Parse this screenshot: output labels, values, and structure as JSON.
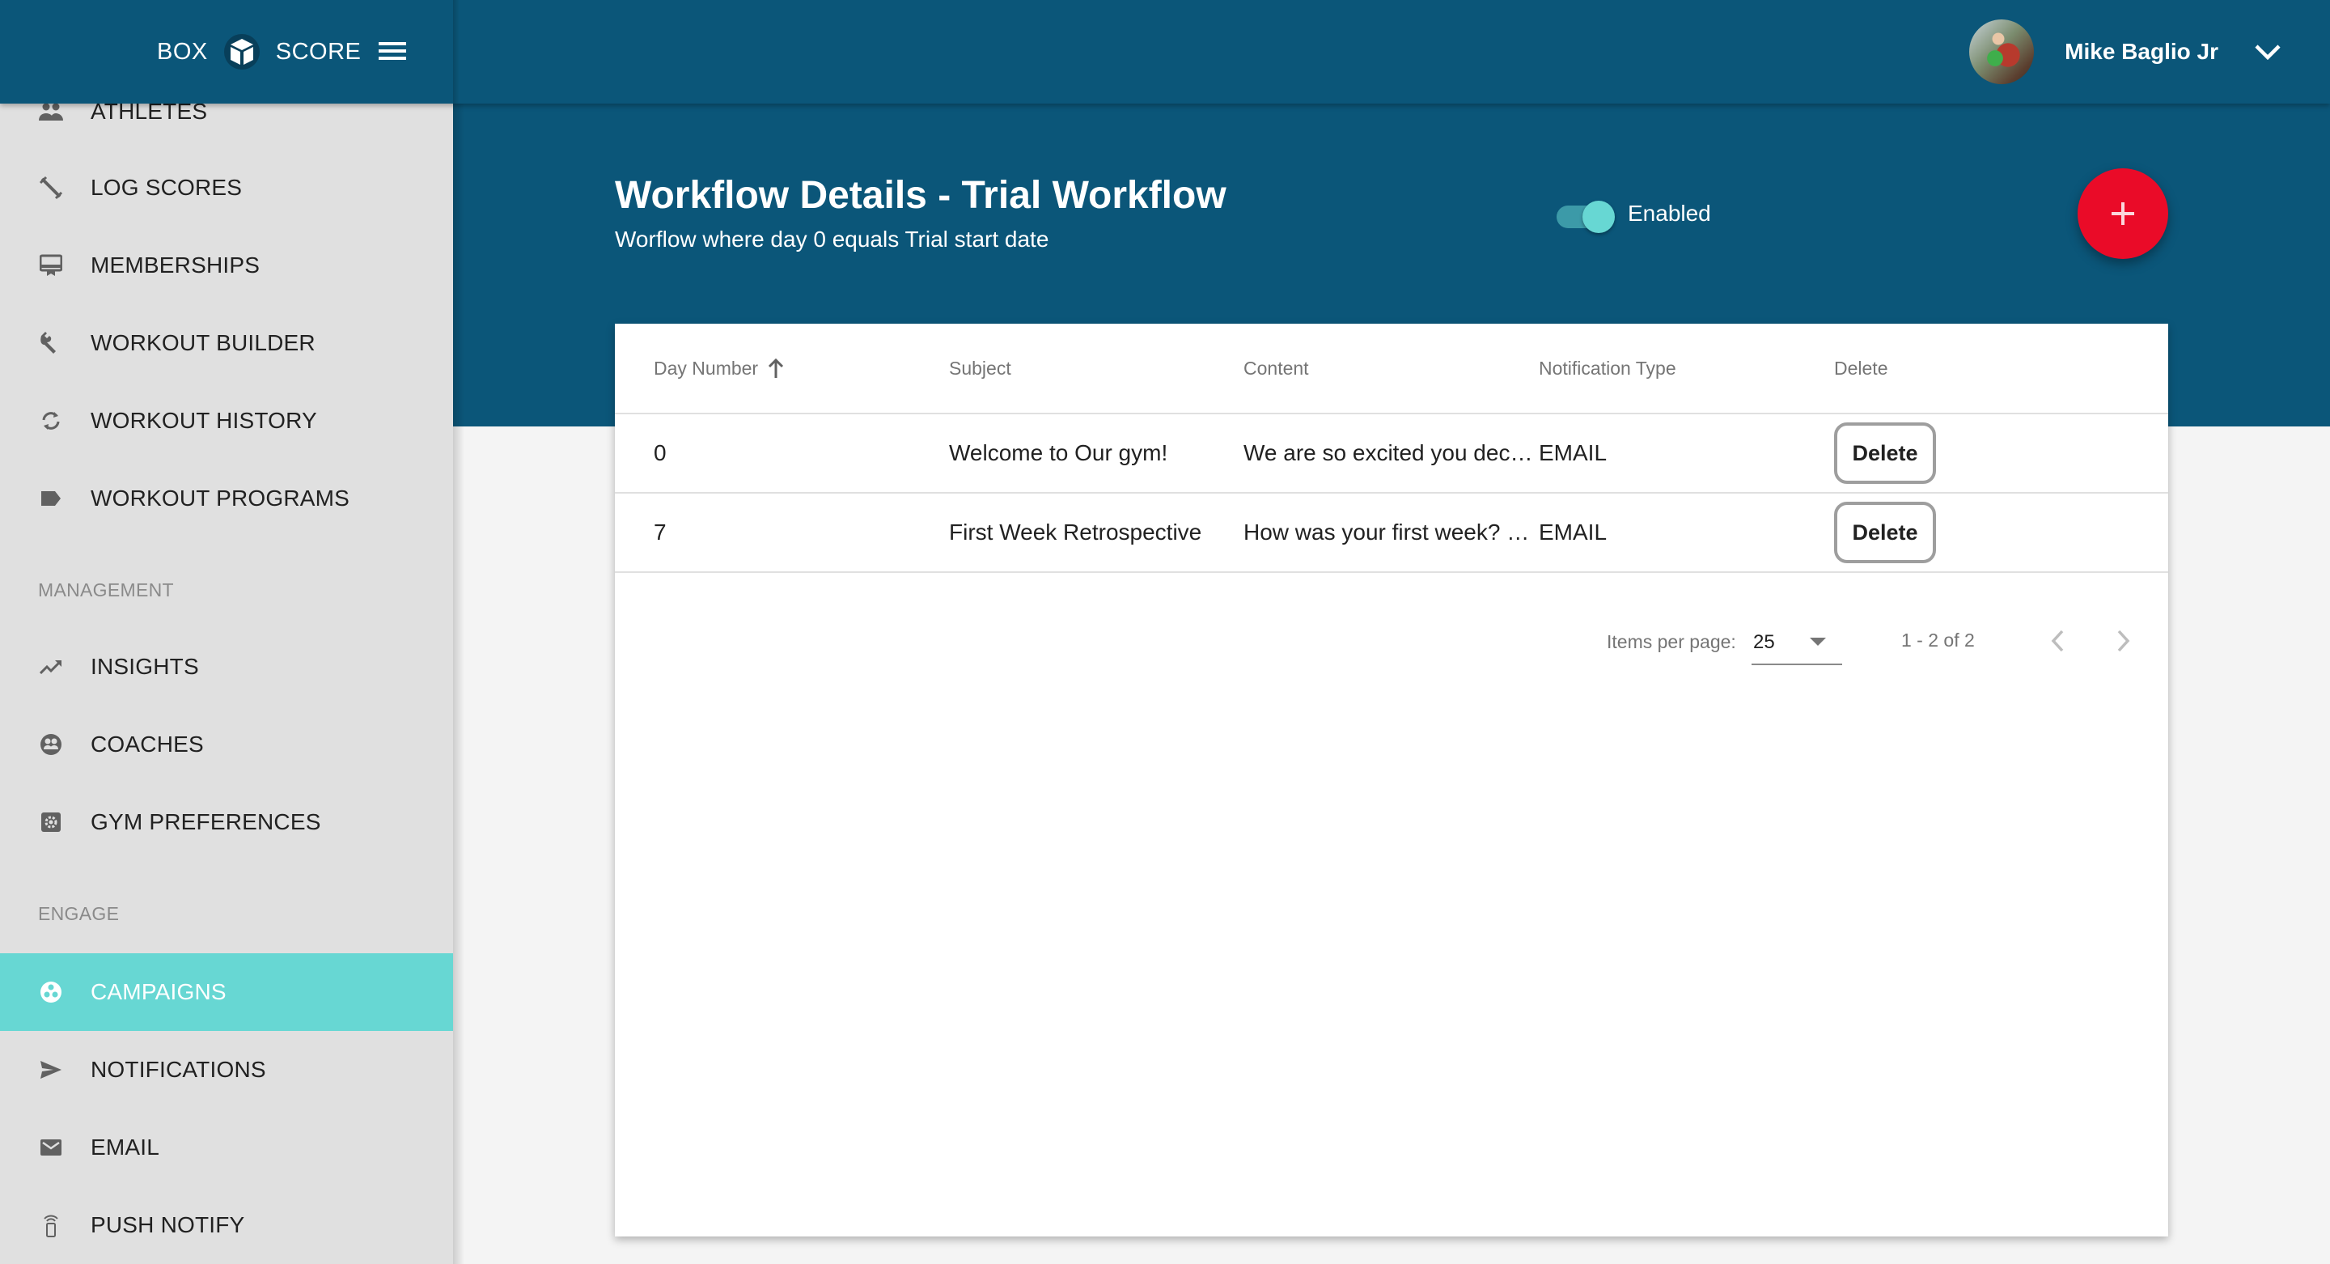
{
  "app": {
    "logo_left": "BOX",
    "logo_right": "SCORE",
    "logo_icon": "cube-icon",
    "menu_icon": "hamburger-menu-icon"
  },
  "user": {
    "name": "Mike Baglio Jr",
    "avatar_icon": "user-avatar",
    "menu_icon": "chevron-down-icon"
  },
  "sidebar": {
    "items": [
      {
        "label": "ATHLETES",
        "icon": "people-icon",
        "active": false
      },
      {
        "label": "LOG SCORES",
        "icon": "barbell-icon",
        "active": false
      },
      {
        "label": "MEMBERSHIPS",
        "icon": "card-membership-icon",
        "active": false
      },
      {
        "label": "WORKOUT BUILDER",
        "icon": "wrench-icon",
        "active": false
      },
      {
        "label": "WORKOUT HISTORY",
        "icon": "sync-icon",
        "active": false
      },
      {
        "label": "WORKOUT PROGRAMS",
        "icon": "label-icon",
        "active": false
      }
    ],
    "sections": [
      {
        "title": "MANAGEMENT",
        "items": [
          {
            "label": "INSIGHTS",
            "icon": "trending-up-icon",
            "active": false
          },
          {
            "label": "COACHES",
            "icon": "group-circle-icon",
            "active": false
          },
          {
            "label": "GYM PREFERENCES",
            "icon": "settings-box-icon",
            "active": false
          }
        ]
      },
      {
        "title": "ENGAGE",
        "items": [
          {
            "label": "CAMPAIGNS",
            "icon": "bubbles-icon",
            "active": true
          },
          {
            "label": "NOTIFICATIONS",
            "icon": "send-icon",
            "active": false
          },
          {
            "label": "EMAIL",
            "icon": "mail-icon",
            "active": false
          },
          {
            "label": "PUSH NOTIFY",
            "icon": "phone-signal-icon",
            "active": false
          }
        ]
      }
    ]
  },
  "page": {
    "title": "Workflow Details - Trial Workflow",
    "subtitle": "Worflow where day 0 equals Trial start date",
    "toggle": {
      "label": "Enabled",
      "checked": true
    },
    "fab_icon": "plus-icon"
  },
  "table": {
    "columns": [
      "Day Number",
      "Subject",
      "Content",
      "Notification Type",
      "Delete"
    ],
    "sort": {
      "column": "Day Number",
      "direction": "ascending"
    },
    "rows": [
      {
        "day": "0",
        "subject": "Welcome to Our gym!",
        "content": "We are so excited you decid...",
        "type": "EMAIL",
        "action": "Delete"
      },
      {
        "day": "7",
        "subject": "First Week Retrospective",
        "content": "How was your first week? L...",
        "type": "EMAIL",
        "action": "Delete"
      }
    ]
  },
  "paginator": {
    "items_per_page_label": "Items per page:",
    "items_per_page": "25",
    "range": "1 - 2 of 2"
  },
  "colors": {
    "primary": "#0b5679",
    "accent": "#67d7d3",
    "fab": "#ea0b28",
    "sidebar_bg": "#e0e0e0"
  }
}
